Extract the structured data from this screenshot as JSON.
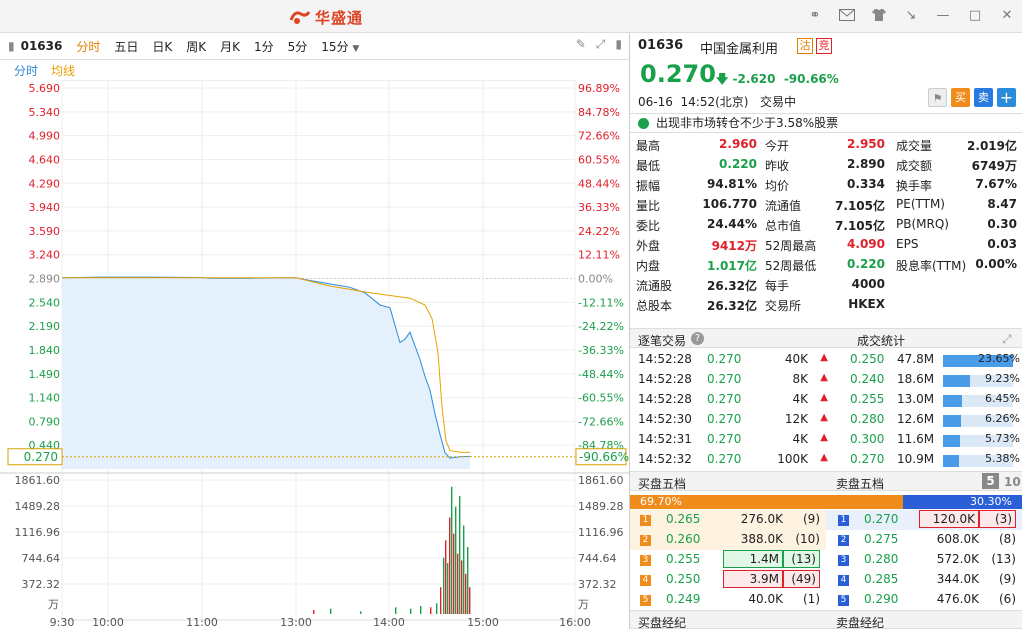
{
  "app": {
    "logo_text": "华盛通"
  },
  "window_icons": [
    "headset-icon",
    "mail-icon",
    "shirt-icon",
    "collapse-icon",
    "minimize-icon",
    "maximize-icon",
    "close-icon"
  ],
  "toolbar": {
    "code": "01636",
    "tabs": [
      "分时",
      "五日",
      "日K",
      "周K",
      "月K",
      "1分",
      "5分",
      "15分"
    ],
    "active_tab": "分时"
  },
  "subtabs": {
    "first": "分时",
    "second": "均线"
  },
  "chart": {
    "price_labels": [
      "5.690",
      "5.340",
      "4.990",
      "4.640",
      "4.290",
      "3.940",
      "3.590",
      "3.240",
      "2.890",
      "2.540",
      "2.190",
      "1.840",
      "1.490",
      "1.140",
      "0.790",
      "0.440"
    ],
    "pct_labels": [
      "96.89%",
      "84.78%",
      "72.66%",
      "60.55%",
      "48.44%",
      "36.33%",
      "24.22%",
      "12.11%",
      "0.00%",
      "-12.11%",
      "-24.22%",
      "-36.33%",
      "-48.44%",
      "-60.55%",
      "-72.66%",
      "-84.78%"
    ],
    "current_price": "0.270",
    "current_pct": "-90.66%",
    "volume_labels": [
      "1861.60",
      "1489.28",
      "1116.96",
      "744.64",
      "372.32"
    ],
    "volume_unit": "万",
    "time_labels": [
      "9:30",
      "10:00",
      "11:00",
      "13:00",
      "14:00",
      "15:00",
      "16:00"
    ]
  },
  "quote": {
    "code": "01636",
    "name": "中国金属利用",
    "badge1": "沽",
    "badge2": "竞",
    "price": "0.270",
    "change": "-2.620",
    "change_pct": "-90.66%",
    "date": "06-16",
    "time": "14:52(北京)",
    "status": "交易中",
    "buy_label": "买",
    "sell_label": "卖",
    "add_label": "+",
    "alert": "出现非市场转仓不少于3.58%股票"
  },
  "stats": [
    [
      {
        "k": "最高",
        "v": "2.960",
        "c": "red"
      },
      {
        "k": "今开",
        "v": "2.950",
        "c": "red"
      },
      {
        "k": "成交量",
        "v": "2.019亿",
        "c": ""
      }
    ],
    [
      {
        "k": "最低",
        "v": "0.220",
        "c": "green"
      },
      {
        "k": "昨收",
        "v": "2.890",
        "c": ""
      },
      {
        "k": "成交额",
        "v": "6749万",
        "c": ""
      }
    ],
    [
      {
        "k": "振幅",
        "v": "94.81%",
        "c": ""
      },
      {
        "k": "均价",
        "v": "0.334",
        "c": ""
      },
      {
        "k": "换手率",
        "v": "7.67%",
        "c": ""
      }
    ],
    [
      {
        "k": "量比",
        "v": "106.770",
        "c": ""
      },
      {
        "k": "流通值",
        "v": "7.105亿",
        "c": ""
      },
      {
        "k": "PE(TTM)",
        "v": "8.47",
        "c": ""
      }
    ],
    [
      {
        "k": "委比",
        "v": "24.44%",
        "c": ""
      },
      {
        "k": "总市值",
        "v": "7.105亿",
        "c": ""
      },
      {
        "k": "PB(MRQ)",
        "v": "0.30",
        "c": ""
      }
    ],
    [
      {
        "k": "外盘",
        "v": "9412万",
        "c": "red"
      },
      {
        "k": "52周最高",
        "v": "4.090",
        "c": "red"
      },
      {
        "k": "EPS",
        "v": "0.03",
        "c": ""
      }
    ],
    [
      {
        "k": "内盘",
        "v": "1.017亿",
        "c": "green"
      },
      {
        "k": "52周最低",
        "v": "0.220",
        "c": "green"
      },
      {
        "k": "股息率(TTM)",
        "v": "0.00%",
        "c": ""
      }
    ],
    [
      {
        "k": "流通股",
        "v": "26.32亿",
        "c": ""
      },
      {
        "k": "每手",
        "v": "4000",
        "c": ""
      }
    ],
    [
      {
        "k": "总股本",
        "v": "26.32亿",
        "c": ""
      },
      {
        "k": "交易所",
        "v": "HKEX",
        "c": ""
      }
    ]
  ],
  "trades_header": "逐笔交易",
  "dist_header": "成交统计",
  "trades": [
    {
      "t": "14:52:28",
      "p": "0.270",
      "v": "40K"
    },
    {
      "t": "14:52:28",
      "p": "0.270",
      "v": "8K"
    },
    {
      "t": "14:52:28",
      "p": "0.270",
      "v": "4K"
    },
    {
      "t": "14:52:30",
      "p": "0.270",
      "v": "12K"
    },
    {
      "t": "14:52:31",
      "p": "0.270",
      "v": "4K"
    },
    {
      "t": "14:52:32",
      "p": "0.270",
      "v": "100K"
    }
  ],
  "distribution": [
    {
      "p": "0.250",
      "v": "47.8M",
      "pct": "23.65%",
      "f": 1.0
    },
    {
      "p": "0.240",
      "v": "18.6M",
      "pct": "9.23%",
      "f": 0.39
    },
    {
      "p": "0.255",
      "v": "13.0M",
      "pct": "6.45%",
      "f": 0.27
    },
    {
      "p": "0.280",
      "v": "12.6M",
      "pct": "6.26%",
      "f": 0.26
    },
    {
      "p": "0.300",
      "v": "11.6M",
      "pct": "5.73%",
      "f": 0.24
    },
    {
      "p": "0.270",
      "v": "10.9M",
      "pct": "5.38%",
      "f": 0.23
    }
  ],
  "orderbook": {
    "bid_header": "买盘五档",
    "ask_header": "卖盘五档",
    "depth_active": "5",
    "depth_other": "10",
    "bid_ratio": "69.70%",
    "ask_ratio": "30.30%",
    "bid_fraction": 0.697,
    "bids": [
      {
        "n": "1",
        "p": "0.265",
        "v": "276.0K",
        "c": "(9)"
      },
      {
        "n": "2",
        "p": "0.260",
        "v": "388.0K",
        "c": "(10)"
      },
      {
        "n": "3",
        "p": "0.255",
        "v": "1.4M",
        "c": "(13)"
      },
      {
        "n": "4",
        "p": "0.250",
        "v": "3.9M",
        "c": "(49)"
      },
      {
        "n": "5",
        "p": "0.249",
        "v": "40.0K",
        "c": "(1)"
      }
    ],
    "asks": [
      {
        "n": "1",
        "p": "0.270",
        "v": "120.0K",
        "c": "(3)"
      },
      {
        "n": "2",
        "p": "0.275",
        "v": "608.0K",
        "c": "(8)"
      },
      {
        "n": "3",
        "p": "0.280",
        "v": "572.0K",
        "c": "(13)"
      },
      {
        "n": "4",
        "p": "0.285",
        "v": "344.0K",
        "c": "(9)"
      },
      {
        "n": "5",
        "p": "0.290",
        "v": "476.0K",
        "c": "(6)"
      }
    ],
    "bid_broker_header": "买盘经纪",
    "ask_broker_header": "卖盘经纪"
  },
  "colors": {
    "up": "#e0202a",
    "down": "#1aa04a",
    "accent": "#e67e00",
    "price_line": "#2a8bd8",
    "avg_line": "#e8a000"
  }
}
